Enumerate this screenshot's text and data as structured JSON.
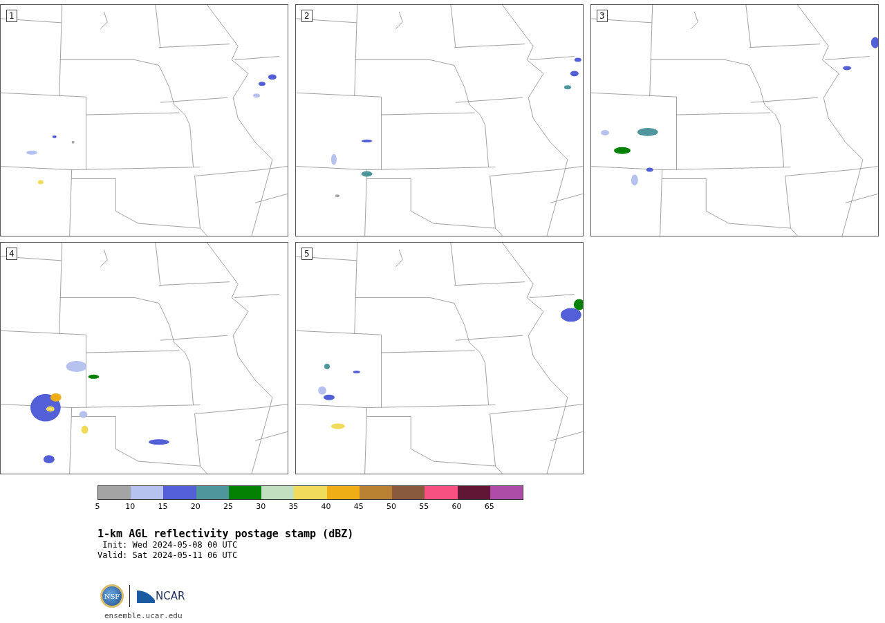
{
  "panels": [
    {
      "label": "1"
    },
    {
      "label": "2"
    },
    {
      "label": "3"
    },
    {
      "label": "4"
    },
    {
      "label": "5"
    }
  ],
  "colorbar": {
    "bins": [
      {
        "color": "#a4a4a4"
      },
      {
        "color": "#b6c2ee"
      },
      {
        "color": "#525fd6"
      },
      {
        "color": "#4e969c"
      },
      {
        "color": "#028102"
      },
      {
        "color": "#bfdfbf"
      },
      {
        "color": "#f0db5a"
      },
      {
        "color": "#f0ae16"
      },
      {
        "color": "#b98232"
      },
      {
        "color": "#8a5a3e"
      },
      {
        "color": "#f65180"
      },
      {
        "color": "#611636"
      },
      {
        "color": "#ac4ca6"
      }
    ],
    "ticks": [
      "5",
      "10",
      "15",
      "20",
      "25",
      "30",
      "35",
      "40",
      "45",
      "50",
      "55",
      "60",
      "65"
    ]
  },
  "title": "1-km AGL reflectivity postage stamp (dBZ)",
  "init": " Init: Wed 2024-05-08 00 UTC",
  "valid": "Valid: Sat 2024-05-11 06 UTC",
  "logo": {
    "nsf": "NSF",
    "ncar": "NCAR"
  },
  "url": "ensemble.ucar.edu"
}
